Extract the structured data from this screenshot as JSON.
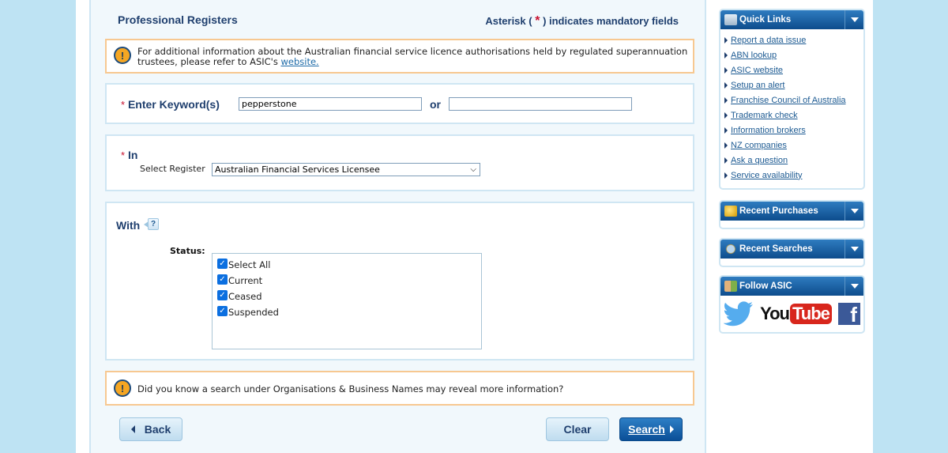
{
  "main": {
    "title": "Professional Registers",
    "mandatory_note": {
      "prefix": "Asterisk (",
      "asterisk": "*",
      "suffix": ") indicates mandatory fields"
    },
    "info_notice": {
      "line1": "For additional information about the Australian financial service licence authorisations held by regulated superannuation",
      "line2_prefix": "trustees, please refer to ASIC's ",
      "link": "website."
    },
    "keyword_section": {
      "asterisk": "*",
      "label": "Enter Keyword(s)",
      "keyword1_value": "pepperstone",
      "or_label": "or",
      "keyword2_value": ""
    },
    "in_section": {
      "asterisk": "*",
      "label": "In",
      "select_label": "Select Register",
      "selected_register": "Australian Financial Services Licensee"
    },
    "with_section": {
      "label": "With",
      "help_glyph": "?",
      "status_label": "Status:",
      "statuses": [
        {
          "label": "Select All",
          "checked": true
        },
        {
          "label": "Current",
          "checked": true
        },
        {
          "label": "Ceased",
          "checked": true
        },
        {
          "label": "Suspended",
          "checked": true
        }
      ]
    },
    "tip_notice": "Did you know a search under Organisations & Business Names may reveal more information?",
    "buttons": {
      "back": "Back",
      "clear": "Clear",
      "search": "Search"
    }
  },
  "sidebar": {
    "quick_links": {
      "title": "Quick Links",
      "items": [
        "Report a data issue",
        "ABN lookup",
        "ASIC website",
        "Setup an alert",
        "Franchise Council of Australia",
        "Trademark check",
        "Information brokers",
        "NZ companies",
        "Ask a question",
        "Service availability"
      ]
    },
    "recent_purchases": {
      "title": "Recent Purchases"
    },
    "recent_searches": {
      "title": "Recent Searches"
    },
    "follow": {
      "title": "Follow ASIC",
      "youtube_you": "You",
      "youtube_tube": "Tube",
      "facebook_glyph": "f"
    }
  },
  "colors": {
    "accent_dark": "#1f3f6e",
    "required": "#c8102e",
    "notice_border": "#f7c891",
    "header_blue": "#0d4c8c"
  }
}
